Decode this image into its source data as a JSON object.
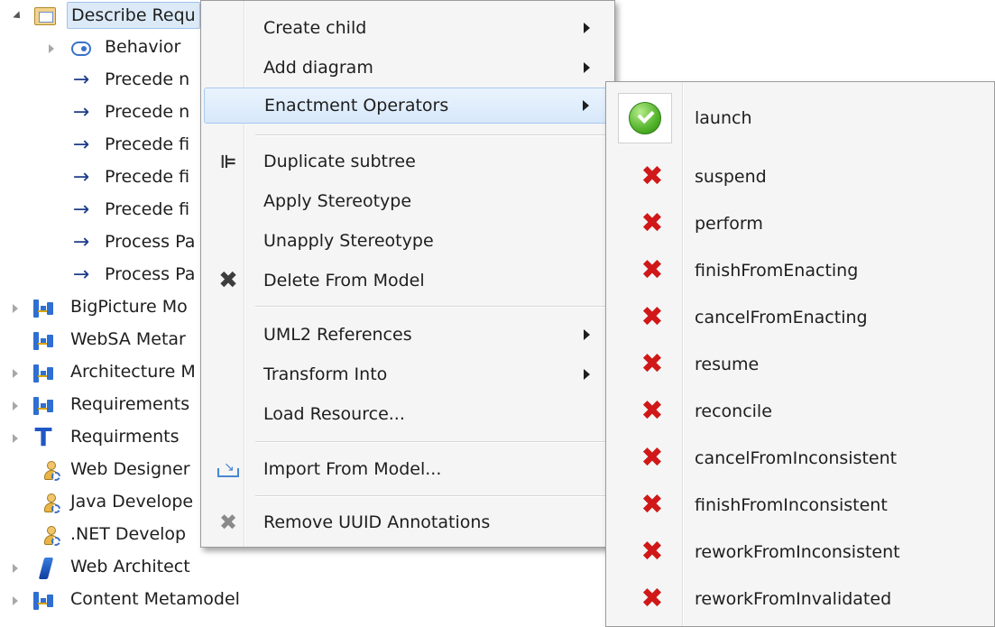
{
  "tree": {
    "items": [
      {
        "label": "Describe Requ",
        "icon": "requirement-diagram-icon",
        "twisty": "open"
      },
      {
        "label": "Behavior",
        "icon": "behavior-icon",
        "twisty": "closed"
      },
      {
        "label": "Precede n",
        "icon": "arrow-right-icon"
      },
      {
        "label": "Precede n",
        "icon": "arrow-right-icon"
      },
      {
        "label": "Precede fi",
        "icon": "arrow-right-icon"
      },
      {
        "label": "Precede fi",
        "icon": "arrow-right-icon"
      },
      {
        "label": "Precede fi",
        "icon": "arrow-right-icon"
      },
      {
        "label": "Process Pa",
        "icon": "arrow-right-icon"
      },
      {
        "label": "Process Pa",
        "icon": "arrow-right-icon"
      },
      {
        "label": "BigPicture Mo",
        "icon": "model-icon",
        "twisty": "closed"
      },
      {
        "label": "WebSA Metar",
        "icon": "model-icon"
      },
      {
        "label": "Architecture M",
        "icon": "model-icon",
        "twisty": "closed"
      },
      {
        "label": "Requirements",
        "icon": "model-icon",
        "twisty": "closed"
      },
      {
        "label": "Requirments",
        "icon": "text-T-icon",
        "twisty": "closed"
      },
      {
        "label": "Web Designer",
        "icon": "role-icon"
      },
      {
        "label": "Java Develope",
        "icon": "role-icon"
      },
      {
        "label": ".NET  Develop",
        "icon": "role-icon"
      },
      {
        "label": "Web Architect",
        "icon": "web-architect-icon",
        "twisty": "closed"
      },
      {
        "label": "Content Metamodel",
        "icon": "model-icon",
        "twisty": "closed"
      }
    ]
  },
  "context_menu": {
    "items": [
      {
        "label": "Create child",
        "submenu": true
      },
      {
        "label": "Add diagram",
        "submenu": true
      },
      {
        "label": "Enactment Operators",
        "submenu": true,
        "highlighted": true
      },
      {
        "label": "Duplicate subtree",
        "icon": "duplicate-subtree-icon"
      },
      {
        "label": "Apply Stereotype"
      },
      {
        "label": "Unapply Stereotype"
      },
      {
        "label": "Delete From Model",
        "icon": "delete-icon"
      },
      {
        "label": "UML2 References",
        "submenu": true
      },
      {
        "label": "Transform Into",
        "submenu": true
      },
      {
        "label": "Load Resource..."
      },
      {
        "label": "Import From Model...",
        "icon": "import-icon"
      },
      {
        "label": "Remove UUID Annotations",
        "icon": "remove-icon"
      }
    ]
  },
  "submenu": {
    "items": [
      {
        "label": "launch",
        "icon": "green-check-icon"
      },
      {
        "label": "suspend",
        "icon": "red-x-icon"
      },
      {
        "label": "perform",
        "icon": "red-x-icon"
      },
      {
        "label": "finishFromEnacting",
        "icon": "red-x-icon"
      },
      {
        "label": "cancelFromEnacting",
        "icon": "red-x-icon"
      },
      {
        "label": "resume",
        "icon": "red-x-icon"
      },
      {
        "label": "reconcile",
        "icon": "red-x-icon"
      },
      {
        "label": "cancelFromInconsistent",
        "icon": "red-x-icon"
      },
      {
        "label": "finishFromInconsistent",
        "icon": "red-x-icon"
      },
      {
        "label": "reworkFromInconsistent",
        "icon": "red-x-icon"
      },
      {
        "label": "reworkFromInvalidated",
        "icon": "red-x-icon"
      }
    ]
  },
  "colors": {
    "menu_background": "#f5f5f5",
    "highlight": "#d7e8fa",
    "accept_green": "#52b32a",
    "reject_red": "#d01818"
  }
}
